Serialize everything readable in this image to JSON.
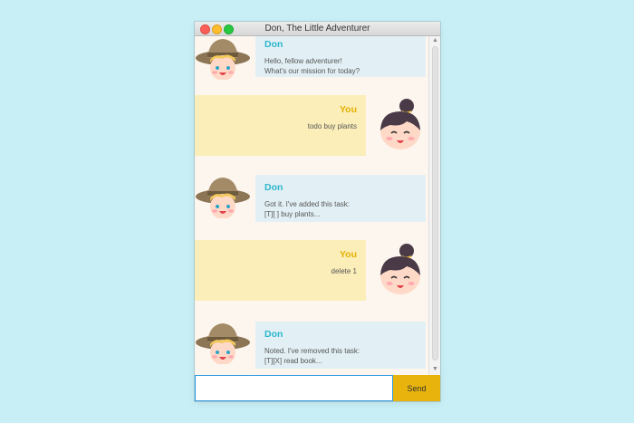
{
  "window": {
    "title": "Don, The Little Adventurer"
  },
  "messages": [
    {
      "speaker": "Don",
      "text": "Hello, fellow adventurer!\nWhat's our mission for today?"
    },
    {
      "speaker": "You",
      "text": "todo buy plants"
    },
    {
      "speaker": "Don",
      "text": "Got it. I've added this task:\n[T][ ] buy plants..."
    },
    {
      "speaker": "You",
      "text": "delete 1"
    },
    {
      "speaker": "Don",
      "text": "Noted. I've removed this task:\n[T][X] read book..."
    }
  ],
  "input": {
    "value": "",
    "placeholder": ""
  },
  "send_label": "Send",
  "icons": {
    "don": "don-explorer-icon",
    "user": "girl-bun-icon",
    "scroll_up": "chevron-up-icon",
    "scroll_down": "chevron-down-icon"
  },
  "colors": {
    "don_bubble": "#e2f0f5",
    "user_bubble": "#fbeeb9",
    "don_name": "#2cb6cc",
    "user_name": "#e3b100",
    "send_button": "#e8b30c"
  }
}
